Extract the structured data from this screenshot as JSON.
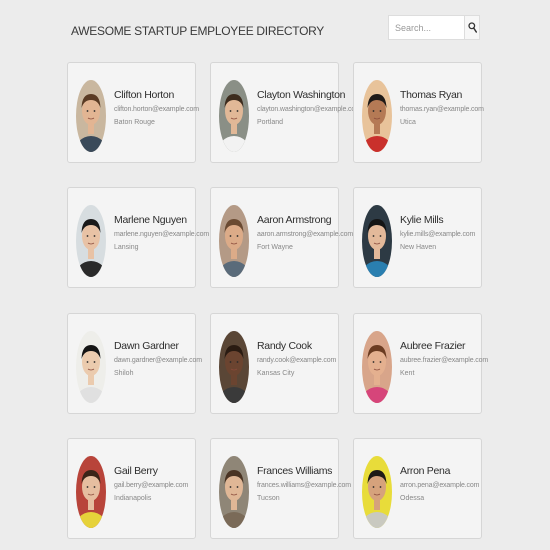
{
  "header": {
    "title": "AWESOME STARTUP EMPLOYEE DIRECTORY"
  },
  "search": {
    "placeholder": "Search...",
    "value": "",
    "button_icon": "magnifier-icon"
  },
  "employees": [
    {
      "name": "Clifton Horton",
      "email": "clifton.horton@example.com",
      "city": "Baton Rouge",
      "bg": "#c9b79f",
      "skin": "#e2b593",
      "hair": "#5a3b24",
      "shirt": "#3a4a5a"
    },
    {
      "name": "Clayton Washington",
      "email": "clayton.washington@example.com",
      "city": "Portland",
      "bg": "#8a8f86",
      "skin": "#e1b897",
      "hair": "#3d2c1e",
      "shirt": "#f2f2f2"
    },
    {
      "name": "Thomas Ryan",
      "email": "thomas.ryan@example.com",
      "city": "Utica",
      "bg": "#e8c39a",
      "skin": "#b57a55",
      "hair": "#1f1a17",
      "shirt": "#c9302c"
    },
    {
      "name": "Marlene Nguyen",
      "email": "marlene.nguyen@example.com",
      "city": "Lansing",
      "bg": "#d7dde0",
      "skin": "#e8c2a5",
      "hair": "#1a1a1a",
      "shirt": "#2a2a2a"
    },
    {
      "name": "Aaron Armstrong",
      "email": "aaron.armstrong@example.com",
      "city": "Fort Wayne",
      "bg": "#b49a86",
      "skin": "#dcab88",
      "hair": "#6a4a32",
      "shirt": "#5a6b7a"
    },
    {
      "name": "Kylie Mills",
      "email": "kylie.mills@example.com",
      "city": "New Haven",
      "bg": "#2d3a44",
      "skin": "#e3b99a",
      "hair": "#141414",
      "shirt": "#2a7fb0"
    },
    {
      "name": "Dawn Gardner",
      "email": "dawn.gardner@example.com",
      "city": "Shiloh",
      "bg": "#eeeeea",
      "skin": "#ebcbae",
      "hair": "#141414",
      "shirt": "#e0e0e0"
    },
    {
      "name": "Randy Cook",
      "email": "randy.cook@example.com",
      "city": "Kansas City",
      "bg": "#5a4636",
      "skin": "#6b4430",
      "hair": "#2a1b12",
      "shirt": "#3a3a3a"
    },
    {
      "name": "Aubree Frazier",
      "email": "aubree.frazier@example.com",
      "city": "Kent",
      "bg": "#d8a58a",
      "skin": "#e4b08f",
      "hair": "#6b3c22",
      "shirt": "#d6457a"
    },
    {
      "name": "Gail Berry",
      "email": "gail.berry@example.com",
      "city": "Indianapolis",
      "bg": "#b8443a",
      "skin": "#e6bea0",
      "hair": "#3a2418",
      "shirt": "#e6d23a"
    },
    {
      "name": "Frances Williams",
      "email": "frances.williams@example.com",
      "city": "Tucson",
      "bg": "#8f8677",
      "skin": "#e0b796",
      "hair": "#4a3424",
      "shirt": "#7a6a58"
    },
    {
      "name": "Arron Pena",
      "email": "arron.pena@example.com",
      "city": "Odessa",
      "bg": "#e8dc3a",
      "skin": "#d6a27c",
      "hair": "#1e1a16",
      "shirt": "#c9c9c0"
    }
  ]
}
